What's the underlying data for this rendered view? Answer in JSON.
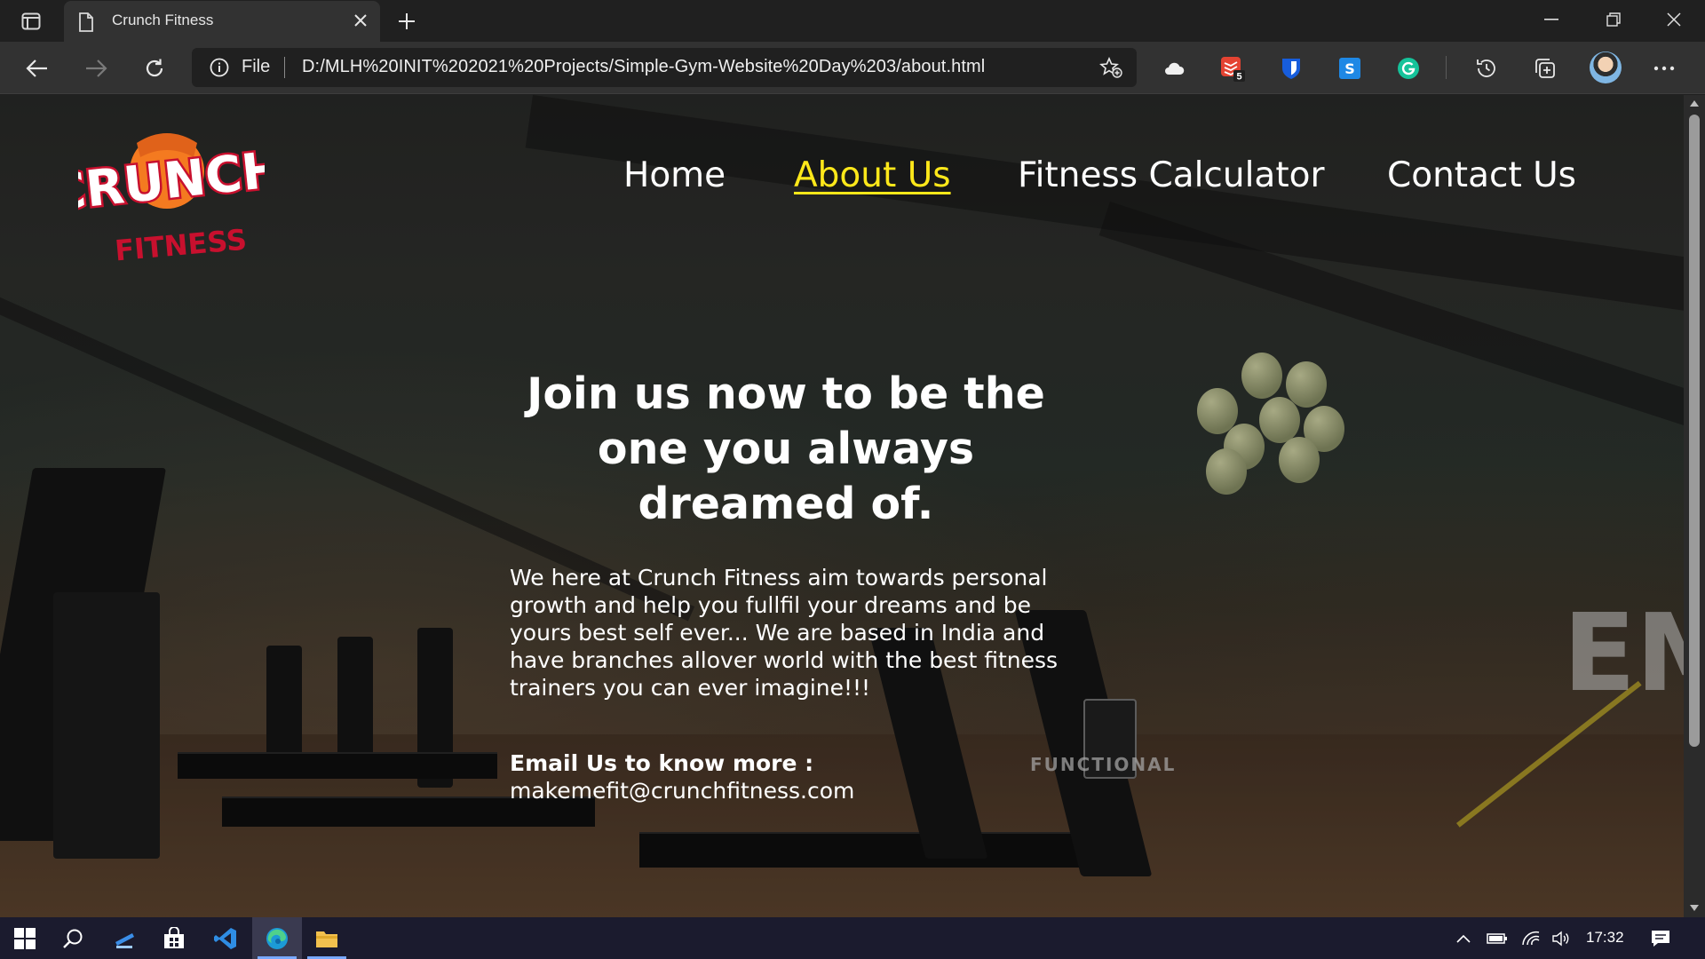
{
  "browser": {
    "tab_title": "Crunch Fitness",
    "address_scheme_label": "File",
    "url": "D:/MLH%20INIT%202021%20Projects/Simple-Gym-Website%20Day%203/about.html",
    "extension_badge": "5"
  },
  "page": {
    "logo": {
      "top_text": "CRUNCH",
      "bottom_text": "FITNESS"
    },
    "nav": [
      {
        "label": "Home"
      },
      {
        "label": "About Us",
        "active": true
      },
      {
        "label": "Fitness Calculator"
      },
      {
        "label": "Contact Us"
      }
    ],
    "hero": {
      "title": "Join us now to be the one you always dreamed of.",
      "body": "We here at Crunch Fitness aim towards personal growth and help you fullfil your dreams and be yours best self ever... We are based in India and have branches allover world with the best fitness trainers you can ever imagine!!!",
      "email_label": "Email Us to know more :",
      "email": "makemefit@crunchfitness.com"
    },
    "background_labels": {
      "wall": "EM",
      "zone": "FUNCTIONAL"
    }
  },
  "taskbar": {
    "time": "17:32"
  },
  "colors": {
    "nav_active": "#ffe81a",
    "logo_red": "#c8102e",
    "logo_orange": "#f47a20"
  }
}
